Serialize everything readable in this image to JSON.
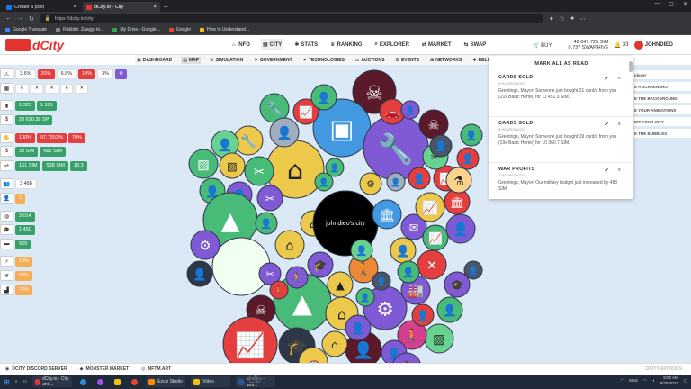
{
  "browser": {
    "tabs": [
      {
        "title": "Create a post",
        "icon_color": "#1a73e8"
      },
      {
        "title": "dCity.io - City",
        "icon_color": "#e3342f"
      }
    ],
    "new_tab": "+",
    "url": "https://dcity.io/city",
    "bookmarks": [
      {
        "label": "Google Translate",
        "color": "#4285f4"
      },
      {
        "label": "Rabbits: Zawgyi to...",
        "color": "#888"
      },
      {
        "label": "My Drive - Google...",
        "color": "#34a853"
      },
      {
        "label": "Google",
        "color": "#ea4335"
      },
      {
        "label": "How to Understand...",
        "color": "#fbbc05"
      }
    ]
  },
  "app": {
    "logo": "dCity",
    "nav": [
      {
        "label": "INFO",
        "icon": "home-icon",
        "glyph": "⌂",
        "active": false
      },
      {
        "label": "CITY",
        "icon": "city-icon",
        "glyph": "▦",
        "active": true
      },
      {
        "label": "STATS",
        "icon": "stats-icon",
        "glyph": "✱",
        "active": false
      },
      {
        "label": "RANKING",
        "icon": "trophy-icon",
        "glyph": "♛",
        "active": false
      },
      {
        "label": "EXPLORER",
        "icon": "search-icon",
        "glyph": "⌕",
        "active": false
      },
      {
        "label": "MARKET",
        "icon": "market-icon",
        "glyph": "⇄",
        "active": false
      },
      {
        "label": "SWAP",
        "icon": "swap-icon",
        "glyph": "⇆",
        "active": false
      }
    ],
    "buy_label": "BUY",
    "balance_sim": "42 047.725 SIM",
    "balance_swap": "0.737 SWAP.HIVE",
    "notif_count": "33",
    "username": "JOHNDIEO"
  },
  "subnav": [
    {
      "label": "DASHBOARD",
      "glyph": "▣",
      "active": false
    },
    {
      "label": "MAP",
      "glyph": "▤",
      "active": true
    },
    {
      "label": "SIMULATION",
      "glyph": "⚙",
      "active": false
    },
    {
      "label": "GOVERNMENT",
      "glyph": "⚑",
      "active": false
    },
    {
      "label": "TECHNOLOGIES",
      "glyph": "✦",
      "active": false
    },
    {
      "label": "AUCTIONS",
      "glyph": "⚖",
      "active": false
    },
    {
      "label": "EVENTS",
      "glyph": "☰",
      "active": false
    },
    {
      "label": "NETWORKS",
      "glyph": "⊞",
      "active": false
    },
    {
      "label": "RELIG",
      "glyph": "✚",
      "active": false
    }
  ],
  "stats": {
    "row1": {
      "icon": "warning-icon",
      "glyph": "⚠",
      "chips": [
        {
          "v": "3.6%",
          "c": "white"
        },
        {
          "v": "20%",
          "c": "red"
        },
        {
          "v": "6.8%",
          "c": "white"
        },
        {
          "v": "14%",
          "c": "red"
        },
        {
          "v": "3%",
          "c": "white"
        },
        {
          "v": "⚙",
          "c": "purple"
        }
      ]
    },
    "row2": {
      "icon": "calendar-icon",
      "glyph": "▦",
      "chips": [
        {
          "v": "✕",
          "c": "white"
        },
        {
          "v": "✕",
          "c": "white"
        },
        {
          "v": "✕",
          "c": "white"
        },
        {
          "v": "✕",
          "c": "white"
        },
        {
          "v": "✕",
          "c": "white"
        }
      ]
    },
    "row3": {
      "icon": "building-icon",
      "glyph": "▮",
      "chips": [
        {
          "v": "1 325",
          "c": "green"
        },
        {
          "v": "1 325",
          "c": "green"
        }
      ]
    },
    "row4": {
      "icon": "money-icon",
      "glyph": "$",
      "chips": [
        {
          "v": "23 620.38 SP",
          "c": "green"
        }
      ]
    },
    "row5": {
      "icon": "hand-icon",
      "glyph": "✋",
      "chips": [
        {
          "v": "100%",
          "c": "red"
        },
        {
          "v": "97.7553%",
          "c": "red"
        },
        {
          "v": "70%",
          "c": "red"
        }
      ]
    },
    "row6": {
      "icon": "dollar-icon",
      "glyph": "$",
      "chips": [
        {
          "v": "33 SIM",
          "c": "green"
        },
        {
          "v": "682 SIM",
          "c": "green"
        }
      ]
    },
    "row7": {
      "icon": "exchange-icon",
      "glyph": "⇄",
      "chips": [
        {
          "v": "161 SIM",
          "c": "green"
        },
        {
          "v": "538 SIM",
          "c": "green"
        },
        {
          "v": "18.3",
          "c": "green"
        }
      ]
    },
    "row8": {
      "icon": "users-icon",
      "glyph": "👥",
      "chips": [
        {
          "v": "3 488",
          "c": "white"
        }
      ]
    },
    "row9": {
      "icon": "user-plus-icon",
      "glyph": "👤",
      "chips": [
        {
          "v": "2",
          "c": "orange"
        }
      ]
    },
    "row10": {
      "icon": "globe-icon",
      "glyph": "◍",
      "chips": [
        {
          "v": "3 014",
          "c": "green"
        }
      ]
    },
    "row11": {
      "icon": "graduation-icon",
      "glyph": "🎓",
      "chips": [
        {
          "v": "1 450",
          "c": "green"
        }
      ]
    },
    "row12": {
      "icon": "briefcase-icon",
      "glyph": "▬",
      "chips": [
        {
          "v": "969",
          "c": "green"
        }
      ]
    },
    "row13": {
      "icon": "bolt-icon",
      "glyph": "⚡",
      "chips": [
        {
          "v": "10%",
          "c": "orange"
        }
      ]
    },
    "row14": {
      "icon": "leaf-icon",
      "glyph": "❦",
      "chips": [
        {
          "v": "63%",
          "c": "orange"
        }
      ]
    },
    "row15": {
      "icon": "factory-icon",
      "glyph": "▟",
      "chips": [
        {
          "v": "72%",
          "c": "orange"
        }
      ]
    }
  },
  "map": {
    "city_name": "johndieo's city",
    "bg_color": "#dbe9f6"
  },
  "notifications": {
    "mark_all": "MARK ALL AS READ",
    "items": [
      {
        "title": "CARDS SOLD",
        "time": "5 HOUR/S AGO",
        "body": "Greetings, Mayor! Someone just bought 21 card/s from you (21x Basic Home) for 11 451.3 SIM."
      },
      {
        "title": "CARDS SOLD",
        "time": "5 HOUR/S AGO",
        "body": "Greetings, Mayor! Someone just bought 19 card/s from you (19x Basic Home) for 10 360.7 SIM."
      },
      {
        "title": "WAR PROFITS",
        "time": "7 HOUR/S AGO",
        "body": "Greetings, Mayor! Our military budget just increased by 483 SIM."
      }
    ]
  },
  "side_menu": [
    "player",
    "E A SCREENSHOT",
    "E THE BACKGROUND",
    "E YOUR ANIMATIONS",
    "DIT YOUR CITY",
    "E THE BUBBLES"
  ],
  "footer": {
    "links": [
      {
        "label": "DCITY DISCORD SERVER",
        "glyph": "◉"
      },
      {
        "label": "MONSTER MARKET",
        "glyph": "◆"
      },
      {
        "label": "NFTM.ART",
        "glyph": "◎"
      }
    ],
    "docs": "DCITY API DOCS"
  },
  "taskbar": {
    "apps": [
      {
        "label": "dCity.io - City and...",
        "color": "#e3342f",
        "wide": true
      },
      {
        "label": "Ezviz Studio",
        "color": "#ff8c00",
        "wide": true
      },
      {
        "label": "Video",
        "color": "#f4c20d",
        "wide": true
      },
      {
        "label": "ကြော်ငြာ - wor...",
        "color": "#2b5797",
        "wide": true
      }
    ],
    "lang": "ENG",
    "time": "9:02 AM",
    "date": "9/25/2022"
  }
}
